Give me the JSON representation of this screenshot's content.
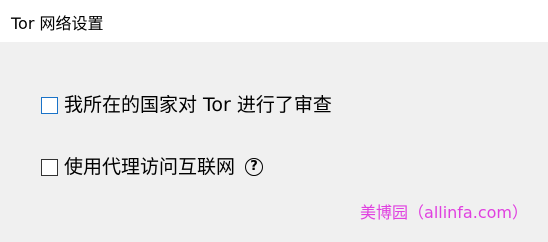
{
  "window": {
    "title": "Tor 网络设置"
  },
  "options": [
    {
      "label": "我所在的国家对 Tor 进行了审查",
      "checked": false
    },
    {
      "label": "使用代理访问互联网",
      "checked": false,
      "help_icon": "?"
    }
  ],
  "watermark": "美博园（allinfa.com）",
  "colors": {
    "focus_border": "#1a73c8",
    "watermark": "#e040e0",
    "background": "#f0f0f0"
  }
}
